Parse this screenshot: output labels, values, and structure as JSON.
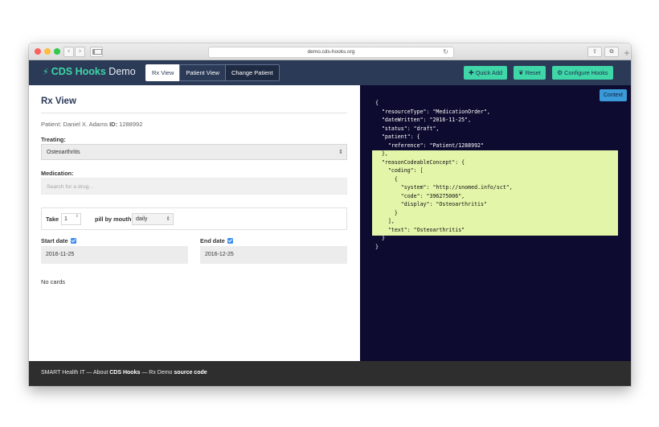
{
  "browser": {
    "url": "demo.cds-hooks.org",
    "back_glyph": "‹",
    "forward_glyph": "›",
    "reload_glyph": "↻",
    "share_glyph": "⇧",
    "tabs_glyph": "⧉",
    "newtab_glyph": "+"
  },
  "navbar": {
    "brand_icon": "⚡",
    "brand_name": "CDS Hooks",
    "brand_suffix": "Demo",
    "tabs": [
      {
        "label": "Rx View"
      },
      {
        "label": "Patient View"
      },
      {
        "label": "Change Patient"
      }
    ],
    "actions": {
      "quick_add": {
        "icon": "✚",
        "label": "Quick Add"
      },
      "reset": {
        "icon": "❦",
        "label": "Reset"
      },
      "configure": {
        "icon": "⚙",
        "label": "Configure Hooks"
      }
    },
    "colors": {
      "navbar": "#2b3a57",
      "accent": "#3fd6a8"
    }
  },
  "rx": {
    "title": "Rx View",
    "patient_label": "Patient:",
    "patient_name": "Daniel X. Adams",
    "id_label": "ID:",
    "patient_id": "1288992",
    "treating_label": "Treating:",
    "treating_value": "Osteoarthritis",
    "select_arrow": "⇕",
    "medication_label": "Medication:",
    "medication_placeholder": "Search for a drug...",
    "take_label": "Take",
    "take_value": "1",
    "spin_glyph": "⇕",
    "pill_label": "pill by mouth",
    "frequency_value": "daily",
    "start_label": "Start date",
    "start_value": "2016-11-25",
    "end_label": "End date",
    "end_value": "2016-12-25",
    "no_cards": "No cards"
  },
  "context": {
    "button_label": "Context",
    "json_lines": [
      "{",
      "  \"resourceType\": \"MedicationOrder\",",
      "  \"dateWritten\": \"2016-11-25\",",
      "  \"status\": \"draft\",",
      "  \"patient\": {",
      "    \"reference\": \"Patient/1288992\"",
      "  },",
      "  \"reasonCodeableConcept\": {",
      "    \"coding\": [",
      "      {",
      "        \"system\": \"http://snomed.info/sct\",",
      "        \"code\": \"396275006\",",
      "        \"display\": \"Osteoarthritis\"",
      "      }",
      "    ],",
      "    \"text\": \"Osteoarthritis\"",
      "  }",
      "}"
    ],
    "highlight_start_line": 6,
    "highlight_end_line": 15,
    "colors": {
      "background": "#0d0b2f",
      "highlight": "#e3f5a8"
    }
  },
  "footer": {
    "org": "SMART Health IT",
    "sep1": "—",
    "about": "About",
    "cds": "CDS Hooks",
    "sep2": "—",
    "rx_demo": "Rx Demo",
    "source": "source code"
  }
}
